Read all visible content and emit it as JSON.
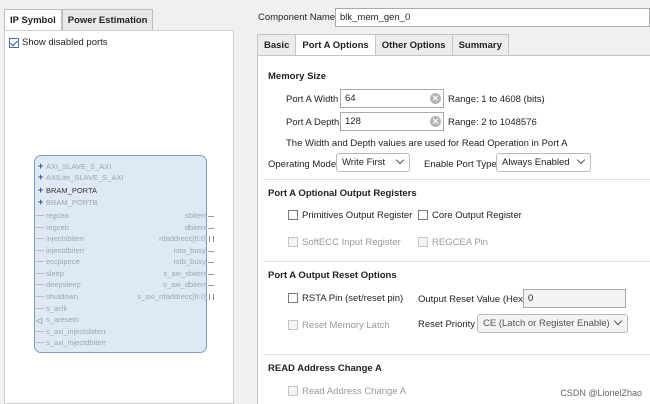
{
  "left": {
    "tabs": [
      "IP Symbol",
      "Power Estimation"
    ],
    "show_disabled_ports": "Show disabled ports",
    "ports_left": [
      {
        "label": "AXI_SLAVE_S_AXI",
        "kind": "bus",
        "dark": false
      },
      {
        "label": "AXILite_SLAVE_S_AXI",
        "kind": "bus",
        "dark": false
      },
      {
        "label": "BRAM_PORTA",
        "kind": "bus",
        "dark": true
      },
      {
        "label": "BRAM_PORTB",
        "kind": "bus",
        "dark": false
      },
      {
        "label": "regcea",
        "kind": "pin"
      },
      {
        "label": "regceb",
        "kind": "pin"
      },
      {
        "label": "injectsbiterr",
        "kind": "pin"
      },
      {
        "label": "injectdbiterr",
        "kind": "pin"
      },
      {
        "label": "eccpipece",
        "kind": "pin"
      },
      {
        "label": "sleep",
        "kind": "pin"
      },
      {
        "label": "deepsleep",
        "kind": "pin"
      },
      {
        "label": "shutdown",
        "kind": "pin"
      },
      {
        "label": "s_aclk",
        "kind": "pin"
      },
      {
        "label": "s_aresetn",
        "kind": "arrow"
      },
      {
        "label": "s_axi_injectsbiterr",
        "kind": "pin"
      },
      {
        "label": "s_axi_injectdbiterr",
        "kind": "pin"
      }
    ],
    "ports_right": [
      {
        "label": "sbiterr",
        "bus": false
      },
      {
        "label": "dbiterr",
        "bus": false
      },
      {
        "label": "rdaddrecc[6:0]",
        "bus": true
      },
      {
        "label": "rsta_busy",
        "bus": false
      },
      {
        "label": "rstb_busy",
        "bus": false
      },
      {
        "label": "s_axi_sbiterr",
        "bus": false
      },
      {
        "label": "s_axi_dbiterr",
        "bus": false
      },
      {
        "label": "s_axi_rdaddrecc[6:0]",
        "bus": true
      }
    ]
  },
  "header": {
    "component_name_label": "Component Name",
    "component_name_value": "blk_mem_gen_0"
  },
  "tabs": [
    "Basic",
    "Port A Options",
    "Other Options",
    "Summary"
  ],
  "memory_size": {
    "title": "Memory Size",
    "width_label": "Port A Width",
    "width_value": "64",
    "width_range": "Range: 1 to 4608 (bits)",
    "depth_label": "Port A Depth",
    "depth_value": "128",
    "depth_range": "Range: 2 to 1048576",
    "note": "The Width and Depth values are used for Read Operation in Port A",
    "op_mode_label": "Operating Mode",
    "op_mode_value": "Write First",
    "enable_type_label": "Enable Port Type",
    "enable_type_value": "Always Enabled"
  },
  "optional_regs": {
    "title": "Port A Optional Output Registers",
    "primitives": "Primitives Output Register",
    "core": "Core Output Register",
    "softecc": "SoftECC Input Register",
    "regcea": "REGCEA Pin"
  },
  "reset": {
    "title": "Port A Output Reset Options",
    "rsta": "RSTA Pin (set/reset pin)",
    "reset_value_label": "Output Reset Value (Hex)",
    "reset_value": "0",
    "reset_mem_latch": "Reset Memory Latch",
    "priority_label": "Reset Priority",
    "priority_value": "CE (Latch or Register Enable)"
  },
  "read_addr": {
    "title": "READ Address Change A",
    "checkbox": "Read Address Change A"
  },
  "watermark": "CSDN @LionelZhao"
}
